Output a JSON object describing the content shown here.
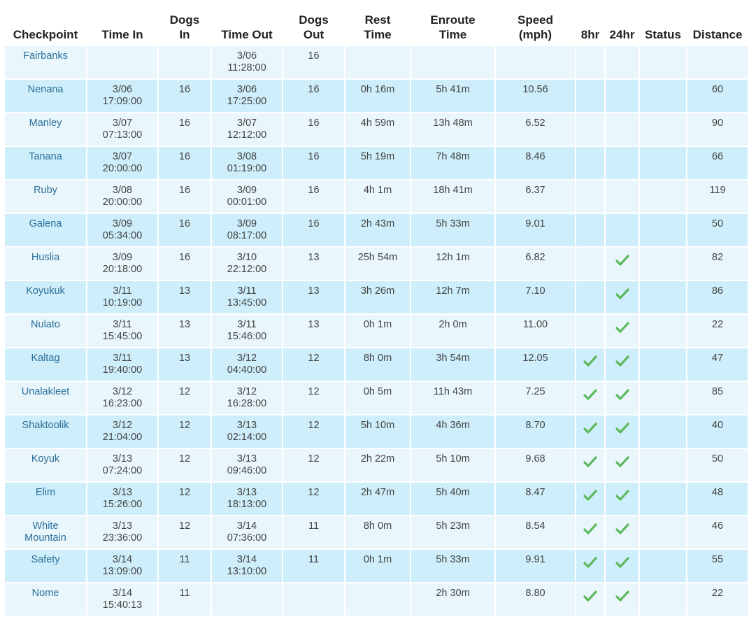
{
  "table": {
    "headers": [
      "Checkpoint",
      "Time In",
      "Dogs In",
      "Time Out",
      "Dogs Out",
      "Rest Time",
      "Enroute Time",
      "Speed (mph)",
      "8hr",
      "24hr",
      "Status",
      "Distance"
    ],
    "header_lines": [
      [
        "Checkpoint",
        ""
      ],
      [
        "Time In",
        ""
      ],
      [
        "Dogs",
        "In"
      ],
      [
        "Time Out",
        ""
      ],
      [
        "Dogs",
        "Out"
      ],
      [
        "Rest",
        "Time"
      ],
      [
        "Enroute",
        "Time"
      ],
      [
        "Speed",
        "(mph)"
      ],
      [
        "8hr",
        ""
      ],
      [
        "24hr",
        ""
      ],
      [
        "Status",
        ""
      ],
      [
        "Distance",
        ""
      ]
    ],
    "rows": [
      {
        "checkpoint": "Fairbanks",
        "checkpoint_line2": "",
        "time_in_date": "",
        "time_in_time": "",
        "dogs_in": "",
        "time_out_date": "3/06",
        "time_out_time": "11:28:00",
        "dogs_out": "16",
        "rest": "",
        "enroute": "",
        "speed": "",
        "r8": false,
        "r24": false,
        "status": "",
        "distance": ""
      },
      {
        "checkpoint": "Nenana",
        "checkpoint_line2": "",
        "time_in_date": "3/06",
        "time_in_time": "17:09:00",
        "dogs_in": "16",
        "time_out_date": "3/06",
        "time_out_time": "17:25:00",
        "dogs_out": "16",
        "rest": "0h 16m",
        "enroute": "5h 41m",
        "speed": "10.56",
        "r8": false,
        "r24": false,
        "status": "",
        "distance": "60"
      },
      {
        "checkpoint": "Manley",
        "checkpoint_line2": "",
        "time_in_date": "3/07",
        "time_in_time": "07:13:00",
        "dogs_in": "16",
        "time_out_date": "3/07",
        "time_out_time": "12:12:00",
        "dogs_out": "16",
        "rest": "4h 59m",
        "enroute": "13h 48m",
        "speed": "6.52",
        "r8": false,
        "r24": false,
        "status": "",
        "distance": "90"
      },
      {
        "checkpoint": "Tanana",
        "checkpoint_line2": "",
        "time_in_date": "3/07",
        "time_in_time": "20:00:00",
        "dogs_in": "16",
        "time_out_date": "3/08",
        "time_out_time": "01:19:00",
        "dogs_out": "16",
        "rest": "5h 19m",
        "enroute": "7h 48m",
        "speed": "8.46",
        "r8": false,
        "r24": false,
        "status": "",
        "distance": "66"
      },
      {
        "checkpoint": "Ruby",
        "checkpoint_line2": "",
        "time_in_date": "3/08",
        "time_in_time": "20:00:00",
        "dogs_in": "16",
        "time_out_date": "3/09",
        "time_out_time": "00:01:00",
        "dogs_out": "16",
        "rest": "4h 1m",
        "enroute": "18h 41m",
        "speed": "6.37",
        "r8": false,
        "r24": false,
        "status": "",
        "distance": "119"
      },
      {
        "checkpoint": "Galena",
        "checkpoint_line2": "",
        "time_in_date": "3/09",
        "time_in_time": "05:34:00",
        "dogs_in": "16",
        "time_out_date": "3/09",
        "time_out_time": "08:17:00",
        "dogs_out": "16",
        "rest": "2h 43m",
        "enroute": "5h 33m",
        "speed": "9.01",
        "r8": false,
        "r24": false,
        "status": "",
        "distance": "50"
      },
      {
        "checkpoint": "Huslia",
        "checkpoint_line2": "",
        "time_in_date": "3/09",
        "time_in_time": "20:18:00",
        "dogs_in": "16",
        "time_out_date": "3/10",
        "time_out_time": "22:12:00",
        "dogs_out": "13",
        "rest": "25h 54m",
        "enroute": "12h 1m",
        "speed": "6.82",
        "r8": false,
        "r24": true,
        "status": "",
        "distance": "82"
      },
      {
        "checkpoint": "Koyukuk",
        "checkpoint_line2": "",
        "time_in_date": "3/11",
        "time_in_time": "10:19:00",
        "dogs_in": "13",
        "time_out_date": "3/11",
        "time_out_time": "13:45:00",
        "dogs_out": "13",
        "rest": "3h 26m",
        "enroute": "12h 7m",
        "speed": "7.10",
        "r8": false,
        "r24": true,
        "status": "",
        "distance": "86"
      },
      {
        "checkpoint": "Nulato",
        "checkpoint_line2": "",
        "time_in_date": "3/11",
        "time_in_time": "15:45:00",
        "dogs_in": "13",
        "time_out_date": "3/11",
        "time_out_time": "15:46:00",
        "dogs_out": "13",
        "rest": "0h 1m",
        "enroute": "2h 0m",
        "speed": "11.00",
        "r8": false,
        "r24": true,
        "status": "",
        "distance": "22"
      },
      {
        "checkpoint": "Kaltag",
        "checkpoint_line2": "",
        "time_in_date": "3/11",
        "time_in_time": "19:40:00",
        "dogs_in": "13",
        "time_out_date": "3/12",
        "time_out_time": "04:40:00",
        "dogs_out": "12",
        "rest": "8h 0m",
        "enroute": "3h 54m",
        "speed": "12.05",
        "r8": true,
        "r24": true,
        "status": "",
        "distance": "47"
      },
      {
        "checkpoint": "Unalakleet",
        "checkpoint_line2": "",
        "time_in_date": "3/12",
        "time_in_time": "16:23:00",
        "dogs_in": "12",
        "time_out_date": "3/12",
        "time_out_time": "16:28:00",
        "dogs_out": "12",
        "rest": "0h 5m",
        "enroute": "11h 43m",
        "speed": "7.25",
        "r8": true,
        "r24": true,
        "status": "",
        "distance": "85"
      },
      {
        "checkpoint": "Shaktoolik",
        "checkpoint_line2": "",
        "time_in_date": "3/12",
        "time_in_time": "21:04:00",
        "dogs_in": "12",
        "time_out_date": "3/13",
        "time_out_time": "02:14:00",
        "dogs_out": "12",
        "rest": "5h 10m",
        "enroute": "4h 36m",
        "speed": "8.70",
        "r8": true,
        "r24": true,
        "status": "",
        "distance": "40"
      },
      {
        "checkpoint": "Koyuk",
        "checkpoint_line2": "",
        "time_in_date": "3/13",
        "time_in_time": "07:24:00",
        "dogs_in": "12",
        "time_out_date": "3/13",
        "time_out_time": "09:46:00",
        "dogs_out": "12",
        "rest": "2h 22m",
        "enroute": "5h 10m",
        "speed": "9.68",
        "r8": true,
        "r24": true,
        "status": "",
        "distance": "50"
      },
      {
        "checkpoint": "Elim",
        "checkpoint_line2": "",
        "time_in_date": "3/13",
        "time_in_time": "15:26:00",
        "dogs_in": "12",
        "time_out_date": "3/13",
        "time_out_time": "18:13:00",
        "dogs_out": "12",
        "rest": "2h 47m",
        "enroute": "5h 40m",
        "speed": "8.47",
        "r8": true,
        "r24": true,
        "status": "",
        "distance": "48"
      },
      {
        "checkpoint": "White",
        "checkpoint_line2": "Mountain",
        "time_in_date": "3/13",
        "time_in_time": "23:36:00",
        "dogs_in": "12",
        "time_out_date": "3/14",
        "time_out_time": "07:36:00",
        "dogs_out": "11",
        "rest": "8h 0m",
        "enroute": "5h 23m",
        "speed": "8.54",
        "r8": true,
        "r24": true,
        "status": "",
        "distance": "46"
      },
      {
        "checkpoint": "Safety",
        "checkpoint_line2": "",
        "time_in_date": "3/14",
        "time_in_time": "13:09:00",
        "dogs_in": "11",
        "time_out_date": "3/14",
        "time_out_time": "13:10:00",
        "dogs_out": "11",
        "rest": "0h 1m",
        "enroute": "5h 33m",
        "speed": "9.91",
        "r8": true,
        "r24": true,
        "status": "",
        "distance": "55"
      },
      {
        "checkpoint": "Nome",
        "checkpoint_line2": "",
        "time_in_date": "3/14",
        "time_in_time": "15:40:13",
        "dogs_in": "11",
        "time_out_date": "",
        "time_out_time": "",
        "dogs_out": "",
        "rest": "",
        "enroute": "2h 30m",
        "speed": "8.80",
        "r8": true,
        "r24": true,
        "status": "",
        "distance": "22"
      }
    ]
  },
  "colors": {
    "row_odd": "#e9f6fc",
    "row_even": "#cdeefa",
    "checkpoint_link": "#2b6f9a",
    "check_green": "#5cb85c"
  },
  "icons": {
    "check": "check-icon"
  }
}
